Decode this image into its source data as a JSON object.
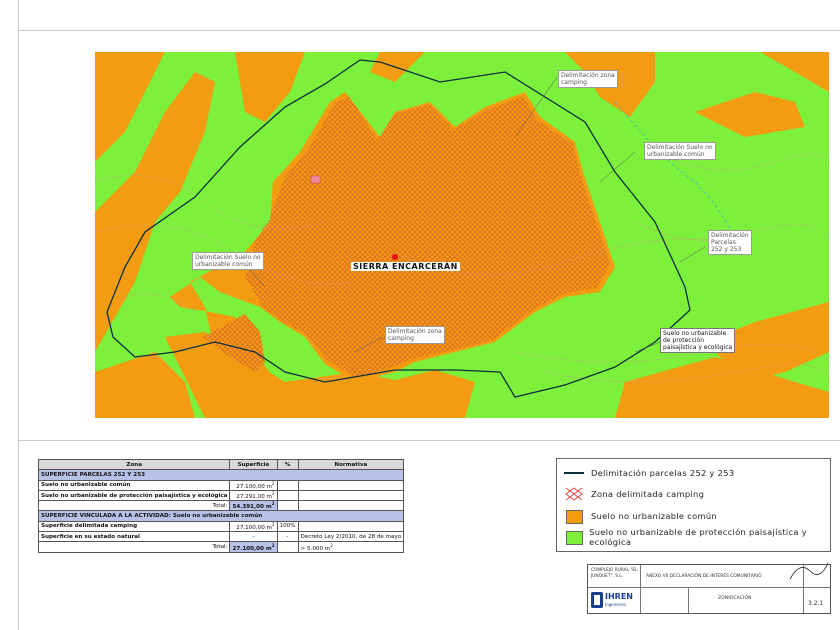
{
  "map": {
    "center_label": "SIERRA ENCARCERÁN",
    "labels": [
      {
        "id": "zona-camping-top",
        "text": "Delimitación zona\ncamping"
      },
      {
        "id": "no-urbanizable-right",
        "text": "Delimitación Suelo no\nurbanizable común"
      },
      {
        "id": "parcelas",
        "text": "Delimitación\nParcelas\n252 y 253"
      },
      {
        "id": "no-urbanizable-left",
        "text": "Delimitación Suelo no\nurbanizable común"
      },
      {
        "id": "zona-camping-bottom",
        "text": "Delimitación zona\ncamping"
      },
      {
        "id": "proteccion",
        "text": "Suelo no urbanizable\nde protección\npaisajística y ecológica"
      }
    ]
  },
  "table": {
    "headers": [
      "Zona",
      "Superficie",
      "%",
      "Normativa"
    ],
    "section1": "SUPERFICIE PARCELAS 252 Y 253",
    "rows1": [
      {
        "zona": "Suelo no urbanizable común",
        "superficie": "27.100,00 m",
        "sup": "2",
        "pct": "",
        "normativa": ""
      },
      {
        "zona": "Suelo no urbanizable de protección paisajística y ecológica",
        "superficie": "27.291,00 m",
        "sup": "2",
        "pct": "",
        "normativa": ""
      }
    ],
    "total1": {
      "label": "Total:",
      "value": "54.391,00 m",
      "sup": "2"
    },
    "section2": "SUPERFICIE VINCULADA A LA ACTIVIDAD: Suelo no urbanizable común",
    "rows2": [
      {
        "zona": "Superficie delimitada camping",
        "superficie": "27.100,00 m",
        "sup": "2",
        "pct": "100%",
        "normativa": ""
      },
      {
        "zona": "Superficie en su estado natural",
        "superficie": "-",
        "sup": "",
        "pct": "-",
        "normativa": "Decreto Ley 2/2010, de 28 de mayo"
      }
    ],
    "total2": {
      "label": "Total:",
      "value": "27.100,00 m",
      "sup": "2",
      "normativa": "> 5.000 m",
      "normativa_sup": "2"
    }
  },
  "legend": [
    {
      "id": "parcelas",
      "text": "Delimitación parcelas 252 y 253",
      "color": "#0b2f3a"
    },
    {
      "id": "camping",
      "text": "Zona delimitada camping",
      "color": "#e8453c"
    },
    {
      "id": "comun",
      "text": "Suelo no urbanizable común",
      "color": "#f39c12"
    },
    {
      "id": "proteccion",
      "text": "Suelo no urbanizable de protección paisajística y ecológica",
      "color": "#7cf03a"
    }
  ],
  "title_block": {
    "client": "COMPLEJO RURAL \"EL\nJUNQUET\", S.L.",
    "annex": "ANEXO VII DECLARACIÓN DE INTERÉS COMUNITARIO",
    "company": "IHREN",
    "company_sub": "Ingenieros",
    "drawing": "ZONIFICACIÓN",
    "number": "3.2.1"
  },
  "colors": {
    "green": "#7cf03a",
    "orange": "#f39c12",
    "boundary": "#0b2f3a"
  }
}
